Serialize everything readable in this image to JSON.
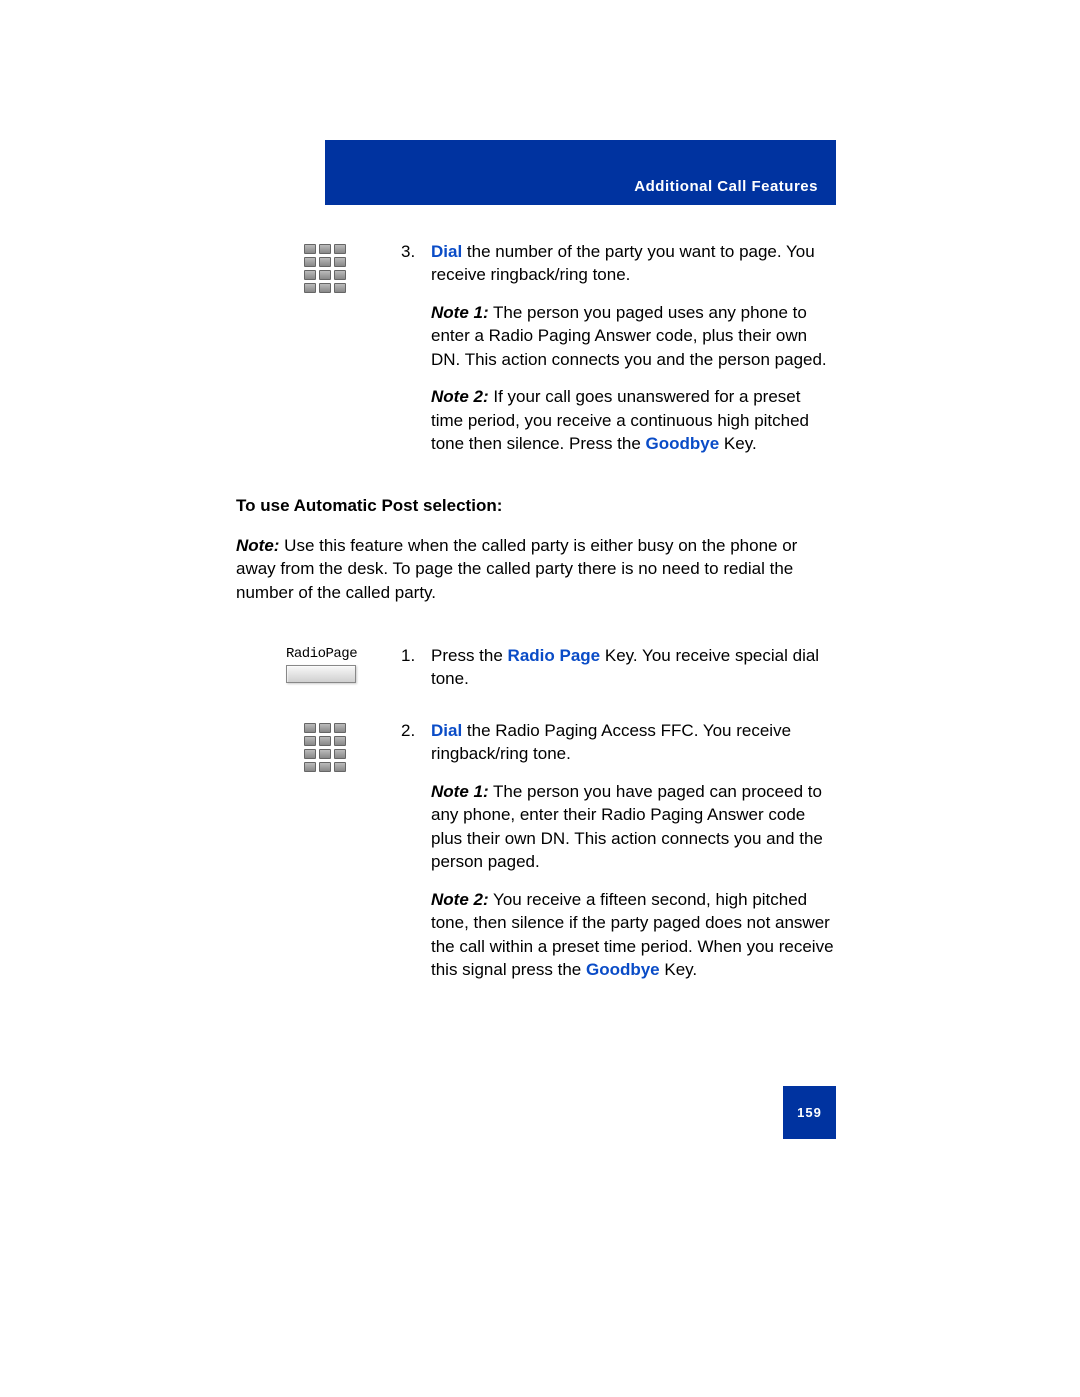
{
  "header": {
    "title": "Additional Call Features"
  },
  "step3": {
    "num": "3.",
    "dial": "Dial",
    "rest": " the number of the party you want to page. You receive ringback/ring tone.",
    "note1_label": "Note 1:",
    "note1": " The person you paged uses any phone to enter a Radio Paging Answer code, plus their own DN. This action connects you and the person paged.",
    "note2_label": "Note 2:",
    "note2_a": " If your call goes unanswered for a preset time period, you receive a continuous high pitched tone then silence. Press the ",
    "goodbye": "Goodbye",
    "note2_b": " Key."
  },
  "section_heading": "To use Automatic Post selection:",
  "intro_note_label": "Note:",
  "intro_note": " Use this feature when the called party is either busy on the phone or away from the desk. To page the called party there is no need to redial the number of the called party.",
  "radio_label": "RadioPage",
  "step1": {
    "num": "1.",
    "a": "Press the ",
    "radio_page": "Radio Page",
    "b": " Key. You receive special dial tone."
  },
  "step2": {
    "num": "2.",
    "dial": "Dial",
    "a": " the Radio Paging Access FFC. You receive ringback/ring tone.",
    "n1_label": "Note 1:",
    "n1": " The person you have paged can proceed to any phone, enter their Radio Paging Answer code plus their own DN. This action connects you and the person paged.",
    "n2_label": "Note 2:",
    "n2_a": " You receive a fifteen second, high pitched tone, then silence if the party paged does not answer the call within a preset time period. When you receive this signal press the ",
    "goodbye": "Goodbye",
    "n2_b": " Key."
  },
  "page_number": "159"
}
